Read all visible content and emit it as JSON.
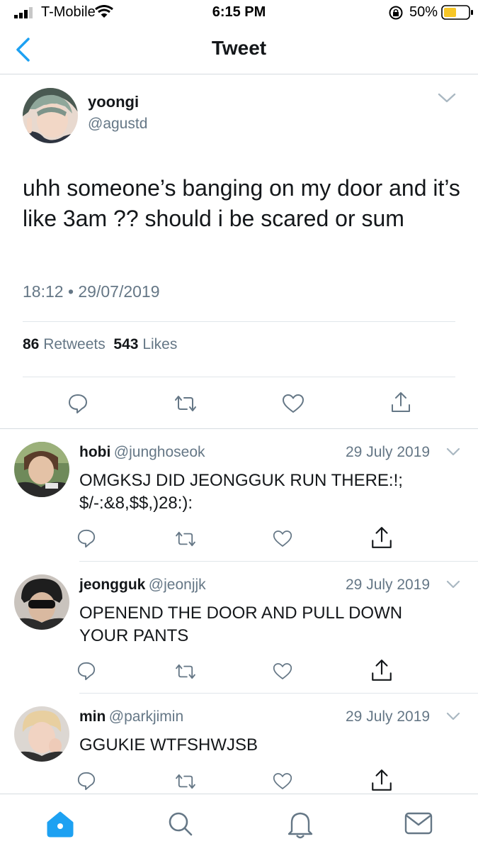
{
  "status_bar": {
    "carrier": "T-Mobile",
    "time": "6:15 PM",
    "battery": "50%",
    "colors": {
      "battery_fill": "#f7c627"
    }
  },
  "nav": {
    "title": "Tweet",
    "back_icon": "chevron-left-icon",
    "accent": "#1da1f2"
  },
  "main_tweet": {
    "name": "yoongi",
    "handle": "@agustd",
    "text": "uhh someone’s banging on my door and it’s like 3am ?? should i be scared or sum",
    "timestamp": "18:12 • 29/07/2019",
    "retweets_count": "86",
    "retweets_label": "Retweets",
    "likes_count": "543",
    "likes_label": "Likes"
  },
  "replies": [
    {
      "name": "hobi",
      "handle": "@junghoseok",
      "date": "29 July 2019",
      "text_line1": "OMGKSJ DID JEONGGUK RUN THERE:!;",
      "text_line2": "$/-:&8,$$,)28:):"
    },
    {
      "name": "jeongguk",
      "handle": "@jeonjjk",
      "date": "29 July 2019",
      "text_line1": "OPENEND THE DOOR AND PULL DOWN",
      "text_line2": "YOUR PANTS"
    },
    {
      "name": "min",
      "handle": "@parkjimin",
      "date": "29 July 2019",
      "text_line1": "GGUKIE WTFSHWJSB",
      "text_line2": ""
    }
  ],
  "tab_bar": {
    "items": [
      "home-icon",
      "search-icon",
      "notifications-icon",
      "messages-icon"
    ],
    "active": "home-icon"
  }
}
